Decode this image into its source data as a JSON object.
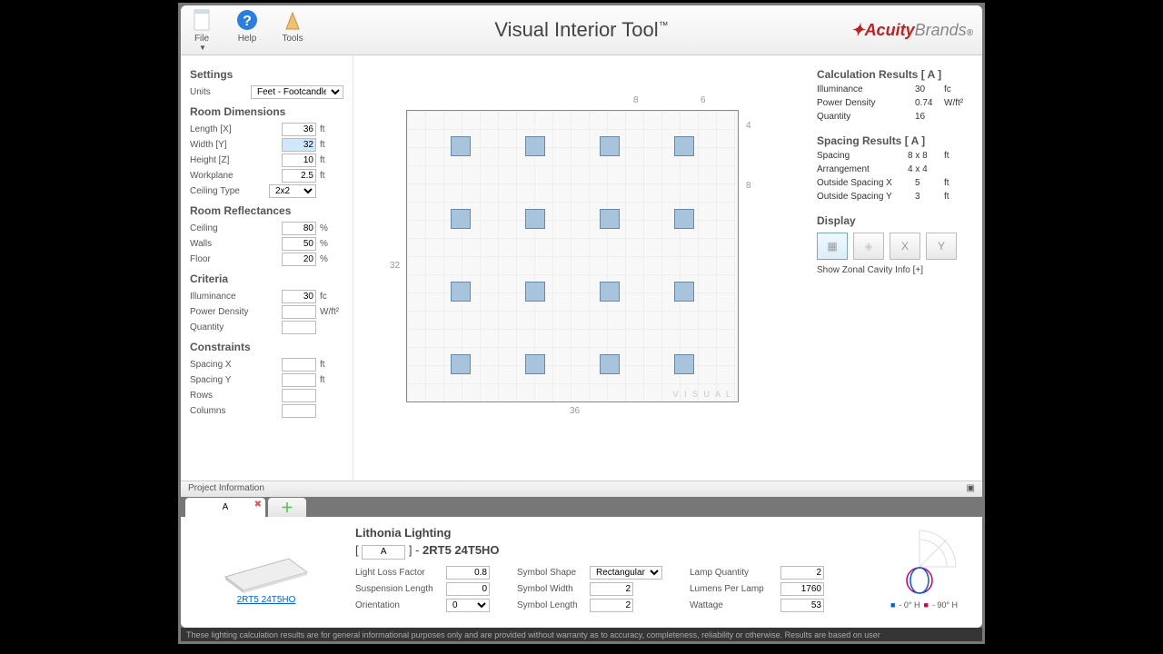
{
  "toolbar": {
    "file": "File",
    "help": "Help",
    "tools": "Tools"
  },
  "title": "Visual Interior Tool",
  "brand": {
    "a": "Acuity",
    "b": "Brands"
  },
  "settings": {
    "h": "Settings",
    "units_label": "Units",
    "units_value": "Feet - Footcandles",
    "room_dim_h": "Room Dimensions",
    "length_l": "Length [X]",
    "length_v": "36",
    "length_u": "ft",
    "width_l": "Width [Y]",
    "width_v": "32",
    "width_u": "ft",
    "height_l": "Height [Z]",
    "height_v": "10",
    "height_u": "ft",
    "wp_l": "Workplane",
    "wp_v": "2.5",
    "wp_u": "ft",
    "ct_l": "Ceiling Type",
    "ct_v": "2x2",
    "refl_h": "Room Reflectances",
    "ceil_l": "Ceiling",
    "ceil_v": "80",
    "pct": "%",
    "walls_l": "Walls",
    "walls_v": "50",
    "floor_l": "Floor",
    "floor_v": "20",
    "crit_h": "Criteria",
    "ill_l": "Illuminance",
    "ill_v": "30",
    "ill_u": "fc",
    "pd_l": "Power Density",
    "pd_v": "",
    "pd_u": "W/ft²",
    "qty_l": "Quantity",
    "qty_v": "",
    "con_h": "Constraints",
    "sx_l": "Spacing X",
    "sx_v": "",
    "ft": "ft",
    "sy_l": "Spacing Y",
    "sy_v": "",
    "rows_l": "Rows",
    "rows_v": "",
    "cols_l": "Columns",
    "cols_v": ""
  },
  "canvas": {
    "w": "36",
    "h": "32",
    "top_a": "8",
    "top_b": "6",
    "right_a": "4",
    "right_b": "8",
    "wm": "V I S U A L"
  },
  "results": {
    "cr_h": "Calculation Results  [ A ]",
    "ill_l": "Illuminance",
    "ill_v": "30",
    "ill_u": "fc",
    "pd_l": "Power Density",
    "pd_v": "0.74",
    "pd_u": "W/ft²",
    "qty_l": "Quantity",
    "qty_v": "16",
    "qty_u": "",
    "sr_h": "Spacing Results  [ A ]",
    "sp_l": "Spacing",
    "sp_v": "8 x 8",
    "sp_u": "ft",
    "ar_l": "Arrangement",
    "ar_v": "4 x 4",
    "ar_u": "",
    "ox_l": "Outside Spacing X",
    "ox_v": "5",
    "ox_u": "ft",
    "oy_l": "Outside Spacing Y",
    "oy_v": "3",
    "oy_u": "ft",
    "disp_h": "Display",
    "zonal": "Show Zonal Cavity Info [+]"
  },
  "proj_info": "Project Information",
  "tab_a": "A",
  "lum": {
    "brand": "Lithonia Lighting",
    "code": "A",
    "model": "2RT5 24T5HO",
    "link": "2RT5 24T5HO",
    "llf_l": "Light Loss Factor",
    "llf_v": "0.8",
    "susp_l": "Suspension Length",
    "susp_v": "0",
    "orient_l": "Orientation",
    "orient_v": "0",
    "shape_l": "Symbol Shape",
    "shape_v": "Rectangular",
    "sw_l": "Symbol Width",
    "sw_v": "2",
    "sl_l": "Symbol Length",
    "sl_v": "2",
    "lq_l": "Lamp Quantity",
    "lq_v": "2",
    "lpl_l": "Lumens Per Lamp",
    "lpl_v": "1760",
    "watt_l": "Wattage",
    "watt_v": "53",
    "photo_0": "- 0° H",
    "photo_90": "- 90° H"
  },
  "footer": "These lighting calculation results are for general informational purposes only and are provided without warranty as to accuracy, completeness, reliability or otherwise. Results are based on user"
}
